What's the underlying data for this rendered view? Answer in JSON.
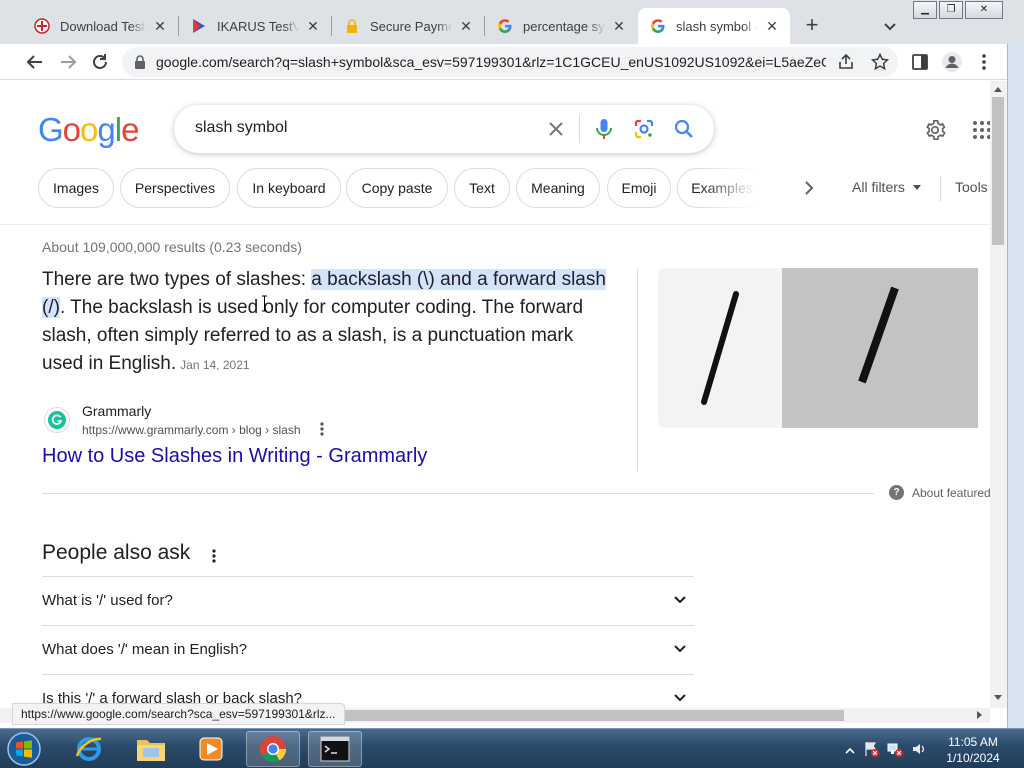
{
  "browser": {
    "tabs": [
      {
        "title": "Download Test Virus",
        "favicon": "shield-red-icon",
        "active": false
      },
      {
        "title": "IKARUS TestVirus",
        "favicon": "play-triangle-icon",
        "active": false
      },
      {
        "title": "Secure Payment",
        "favicon": "padlock-icon",
        "active": false
      },
      {
        "title": "percentage symbol",
        "favicon": "google-g-icon",
        "active": false
      },
      {
        "title": "slash symbol - Google",
        "favicon": "google-g-icon",
        "active": true
      }
    ],
    "new_tab_label": "+",
    "url": "google.com/search?q=slash+symbol&sca_esv=597199301&rlz=1C1GCEU_enUS1092US1092&ei=L5aeZeC...",
    "status_url": "https://www.google.com/search?sca_esv=597199301&rlz..."
  },
  "search": {
    "logo_text": "Google",
    "query": "slash symbol",
    "chips": [
      "Images",
      "Perspectives",
      "In keyboard",
      "Copy paste",
      "Text",
      "Meaning",
      "Emoji",
      "Examples"
    ],
    "all_filters": "All filters",
    "tools": "Tools",
    "stats": "About 109,000,000 results (0.23 seconds)"
  },
  "featured": {
    "text_before": "There are two types of slashes: ",
    "text_highlight": "a backslash (\\) and a forward slash (/)",
    "text_after": ". The backslash is used only for computer coding. The forward slash, often simply referred to as a slash, is a punctuation mark used in English.",
    "date": "Jan 14, 2021",
    "source_name": "Grammarly",
    "source_url": "https://www.grammarly.com › blog › slash",
    "link_title": "How to Use Slashes in Writing - Grammarly",
    "about_label": "About featured snippets"
  },
  "paa": {
    "title": "People also ask",
    "questions": [
      "What is '/' used for?",
      "What does '/' mean in English?",
      "Is this '/' a forward slash or back slash?"
    ]
  },
  "taskbar": {
    "time": "11:05 AM",
    "date": "1/10/2024"
  },
  "colors": {
    "google_blue": "#4285f4",
    "google_red": "#ea4335",
    "google_yellow": "#fbbc05",
    "google_green": "#34a853",
    "link": "#1a0dab",
    "highlight": "#d3e3fd"
  }
}
